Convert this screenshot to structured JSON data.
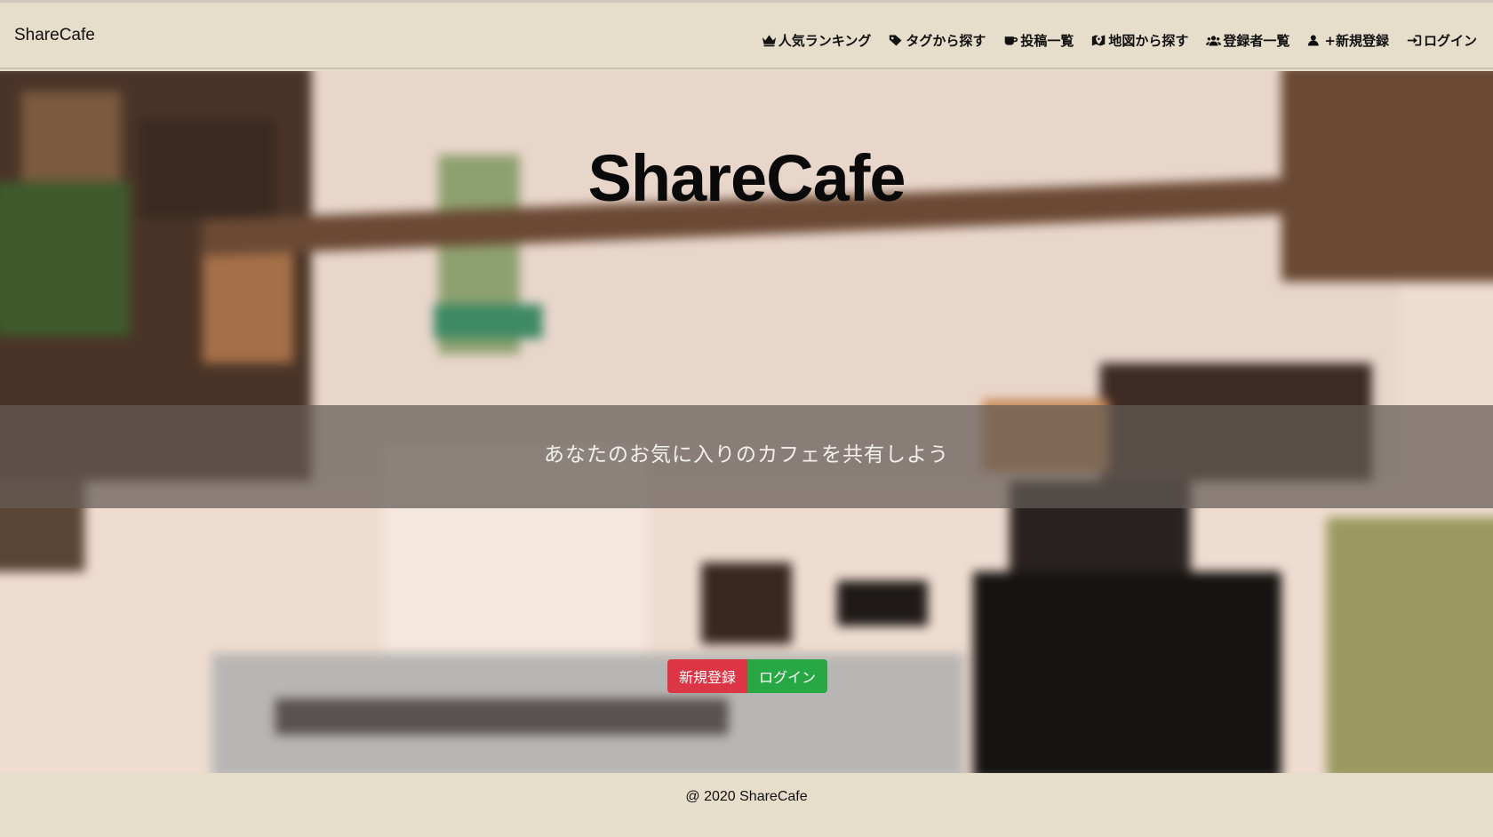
{
  "brand": "ShareCafe",
  "nav": [
    {
      "label": "人気ランキング",
      "icon": "crown-icon"
    },
    {
      "label": "タグから探す",
      "icon": "tags-icon"
    },
    {
      "label": "投稿一覧",
      "icon": "coffee-icon"
    },
    {
      "label": "地図から探す",
      "icon": "map-icon"
    },
    {
      "label": "登録者一覧",
      "icon": "users-icon"
    },
    {
      "label": "+新規登録",
      "icon": "user-plus-icon"
    },
    {
      "label": "ログイン",
      "icon": "sign-in-icon"
    }
  ],
  "hero": {
    "title": "ShareCafe",
    "tagline": "あなたのお気に入りのカフェを共有しよう",
    "register_label": "新規登録",
    "login_label": "ログイン"
  },
  "footer": {
    "text": "@ 2020 ShareCafe"
  },
  "colors": {
    "navbar": "#e6ddcb",
    "register": "#dc3545",
    "login": "#28a745"
  }
}
